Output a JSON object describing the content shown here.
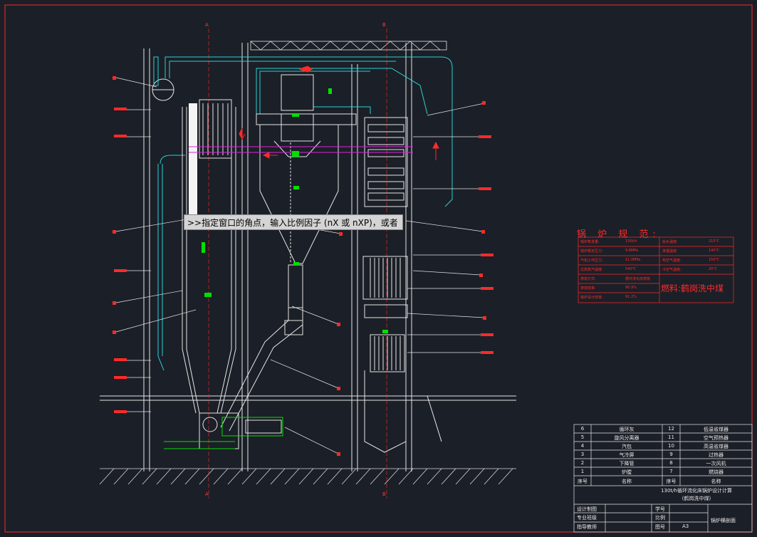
{
  "command_prompt": ">>指定窗口的角点，输入比例因子 (nX 或 nXP)，或者",
  "axes": {
    "a_top": "A",
    "b_top": "B",
    "a_bottom": "A",
    "b_bottom": "B"
  },
  "spec": {
    "title": "锅 炉 规 范:",
    "fuel": "燃料:鹤岗洗中煤",
    "rows": [
      [
        "锅炉蒸发量:",
        "130t/h",
        "给水温度:",
        "215℃"
      ],
      [
        "锅炉额定压力:",
        "9.8MPa",
        "排烟温度:",
        "140℃"
      ],
      [
        "汽包工作压力:",
        "11.0MPa",
        "热空气温度:",
        "150℃"
      ],
      [
        "过热蒸汽温度:",
        "540℃",
        "冷空气温度:",
        "20℃"
      ],
      [
        "燃烧方式:",
        "循环流化床燃烧",
        "",
        ""
      ],
      [
        "排放效率:",
        "90.9%",
        "",
        ""
      ],
      [
        "锅炉设计效率:",
        "91.2%",
        "",
        ""
      ]
    ]
  },
  "parts": {
    "rows": [
      [
        "6",
        "循环灰",
        "12",
        "低温省煤器"
      ],
      [
        "5",
        "旋风分离器",
        "11",
        "空气预热器"
      ],
      [
        "4",
        "汽包",
        "10",
        "高温省煤器"
      ],
      [
        "3",
        "气冷屏",
        "9",
        "过热器"
      ],
      [
        "2",
        "下降管",
        "8",
        "一次风机"
      ],
      [
        "1",
        "炉膛",
        "7",
        "燃烧器"
      ]
    ],
    "header": [
      "序号",
      "名称",
      "序号",
      "名称"
    ]
  },
  "title_block": {
    "project": "130t/h循环流化床锅炉设计计算",
    "subtitle": "(鹤岗洗中煤)",
    "drawn": "设计制图",
    "major": "专业班级",
    "advisor": "指导教师",
    "student_no": "学号",
    "scale": "比例",
    "sheet": "图号",
    "sheet_value": "A3",
    "drawing_name": "锅炉横剖面"
  },
  "colors": {
    "background": "#1b1f27",
    "frame": "#ff2a2a",
    "lines": "#e6e6e6",
    "water": "#29d2d6",
    "accent": "#00e000",
    "magenta": "#e020e0"
  }
}
